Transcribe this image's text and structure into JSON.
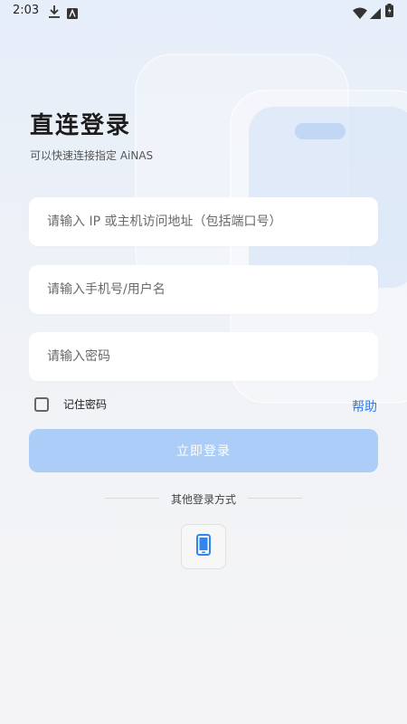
{
  "status_bar": {
    "time": "2:03"
  },
  "header": {
    "title": "直连登录",
    "subtitle": "可以快速连接指定 AiNAS"
  },
  "form": {
    "address_placeholder": "请输入 IP 或主机访问地址（包括端口号）",
    "username_placeholder": "请输入手机号/用户名",
    "password_placeholder": "请输入密码",
    "remember_label": "记住密码",
    "remember_checked": false,
    "help_label": "帮助",
    "login_label": "立即登录"
  },
  "other_login": {
    "divider_text": "其他登录方式",
    "options": [
      {
        "icon": "phone-icon"
      }
    ]
  },
  "colors": {
    "accent": "#2f7be6",
    "login_button_disabled": "#abcdf7",
    "phone_icon": "#2f86f0"
  }
}
